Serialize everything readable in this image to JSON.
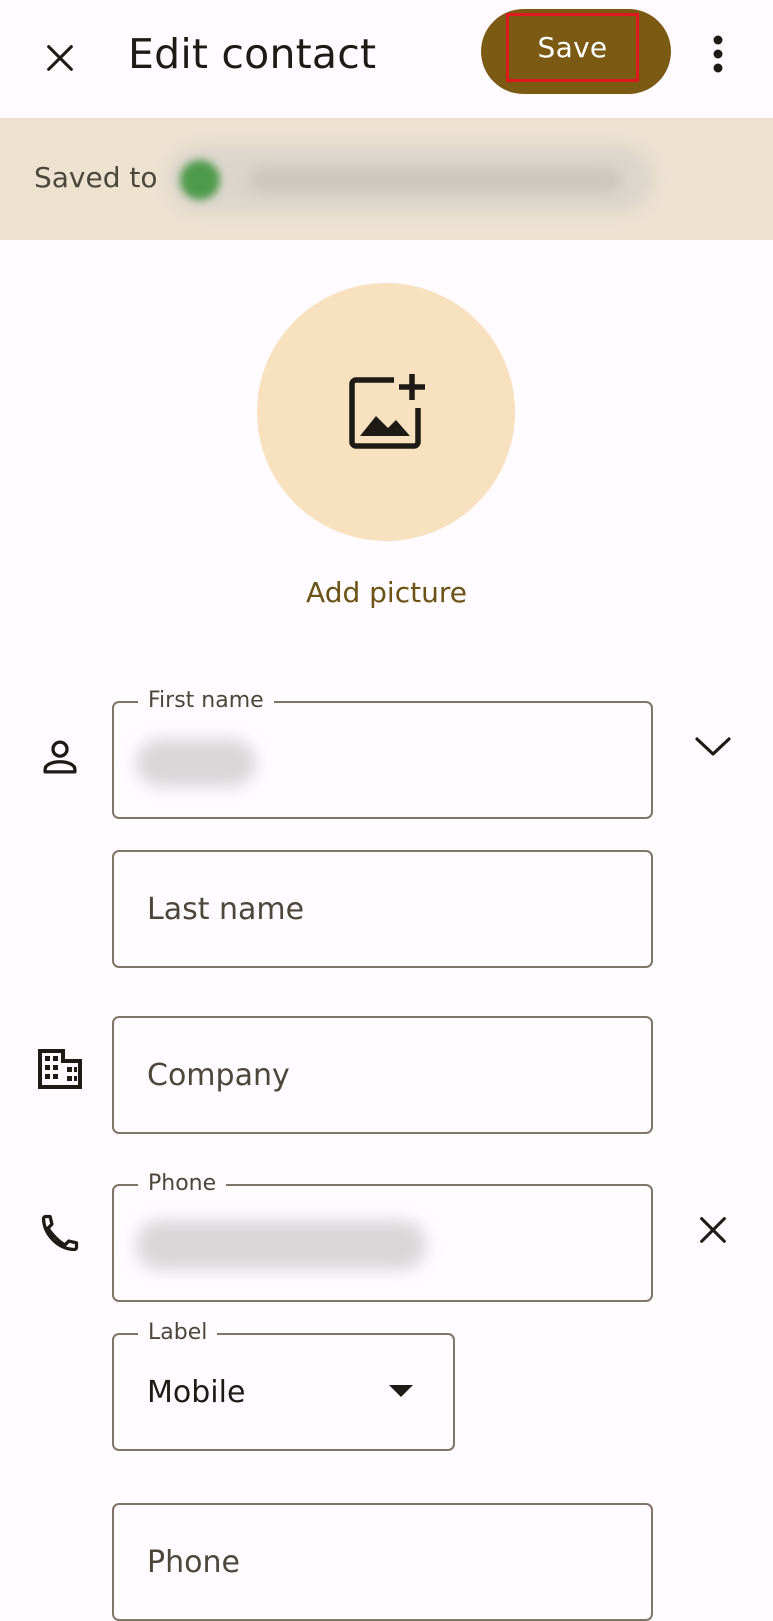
{
  "header": {
    "title": "Edit contact",
    "save_label": "Save",
    "close_icon": "close-icon",
    "more_icon": "more-vert-icon"
  },
  "saved_to": {
    "label": "Saved to"
  },
  "picture": {
    "icon": "add-photo-icon",
    "add_label": "Add picture"
  },
  "fields": {
    "first_name": {
      "label": "First name"
    },
    "last_name": {
      "placeholder": "Last name"
    },
    "company": {
      "placeholder": "Company"
    },
    "phone": {
      "label": "Phone"
    },
    "phone_label": {
      "label": "Label",
      "value": "Mobile"
    },
    "phone2": {
      "placeholder": "Phone"
    }
  },
  "colors": {
    "primary": "#7b5a14",
    "banner": "#ede2d0",
    "photo_bg": "#f8e1bf",
    "highlight": "#e0191f",
    "background": "#fffbff"
  }
}
